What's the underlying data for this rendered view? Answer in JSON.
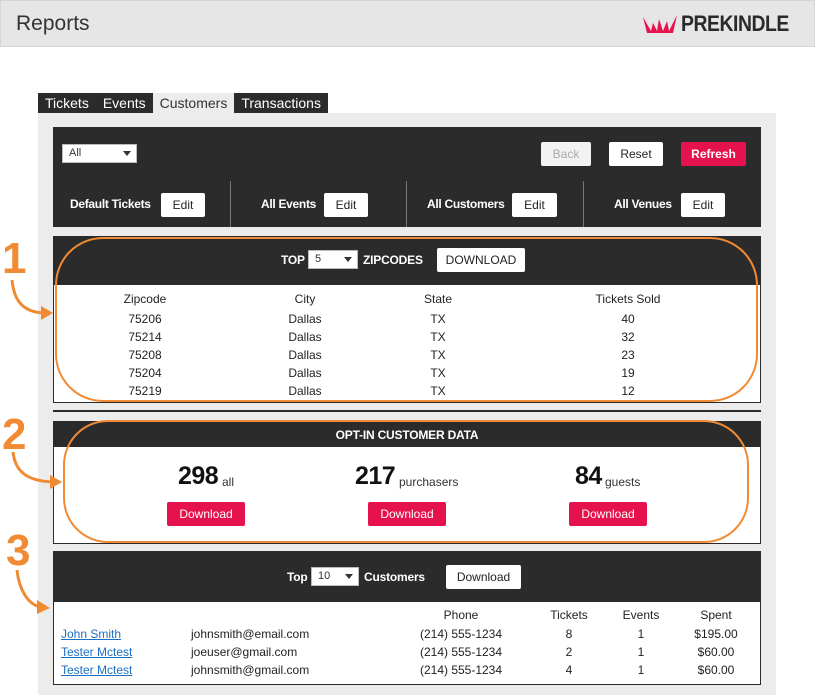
{
  "header": {
    "title": "Reports",
    "brand": "PREKINDLE",
    "brand_color": "#e5124e"
  },
  "tabs": [
    "Tickets",
    "Events",
    "Customers",
    "Transactions"
  ],
  "active_tab": "Customers",
  "filters": {
    "select_value": "All",
    "back": "Back",
    "reset": "Reset",
    "refresh": "Refresh",
    "items": [
      {
        "label": "Default Tickets",
        "button": "Edit"
      },
      {
        "label": "All Events",
        "button": "Edit"
      },
      {
        "label": "All Customers",
        "button": "Edit"
      },
      {
        "label": "All Venues",
        "button": "Edit"
      }
    ]
  },
  "zipcodes": {
    "prefix": "TOP",
    "count": "5",
    "suffix": "ZIPCODES",
    "download": "DOWNLOAD",
    "columns": [
      "Zipcode",
      "City",
      "State",
      "Tickets Sold"
    ],
    "rows": [
      [
        "75206",
        "Dallas",
        "TX",
        "40"
      ],
      [
        "75214",
        "Dallas",
        "TX",
        "32"
      ],
      [
        "75208",
        "Dallas",
        "TX",
        "23"
      ],
      [
        "75204",
        "Dallas",
        "TX",
        "19"
      ],
      [
        "75219",
        "Dallas",
        "TX",
        "12"
      ]
    ]
  },
  "optin": {
    "title": "OPT-IN CUSTOMER DATA",
    "stats": [
      {
        "value": "298",
        "label": "all",
        "button": "Download"
      },
      {
        "value": "217",
        "label": "purchasers",
        "button": "Download"
      },
      {
        "value": "84",
        "label": "guests",
        "button": "Download"
      }
    ]
  },
  "customers": {
    "prefix": "Top",
    "count": "10",
    "suffix": "Customers",
    "download": "Download",
    "columns": [
      "Phone",
      "Tickets",
      "Events",
      "Spent"
    ],
    "rows": [
      {
        "name": "John Smith",
        "email": "johnsmith@email.com",
        "phone": "(214) 555-1234",
        "tickets": "8",
        "events": "1",
        "spent": "$195.00"
      },
      {
        "name": "Tester Mctest",
        "email": "joeuser@gmail.com",
        "phone": "(214) 555-1234",
        "tickets": "2",
        "events": "1",
        "spent": "$60.00"
      },
      {
        "name": "Tester Mctest",
        "email": "johnsmith@gmail.com",
        "phone": "(214) 555-1234",
        "tickets": "4",
        "events": "1",
        "spent": "$60.00"
      }
    ]
  },
  "annotations": {
    "markers": [
      "1",
      "2",
      "3"
    ],
    "color": "#f08a33"
  }
}
